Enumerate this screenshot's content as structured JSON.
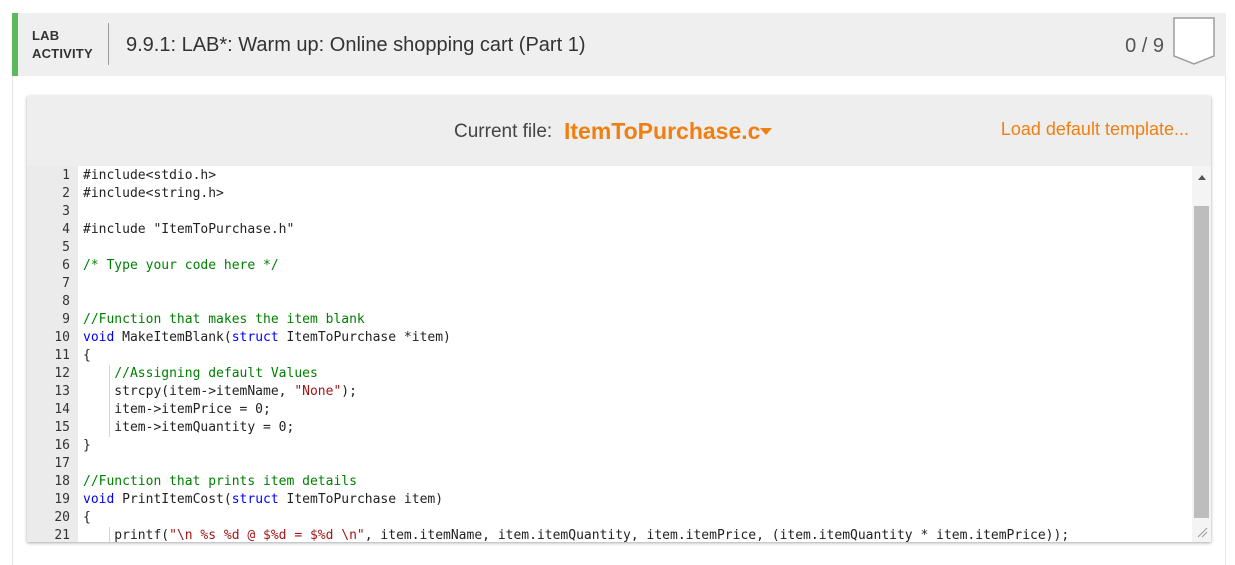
{
  "header": {
    "lab_label_line1": "LAB",
    "lab_label_line2": "ACTIVITY",
    "title": "9.9.1: LAB*: Warm up: Online shopping cart (Part 1)",
    "score": "0 / 9",
    "accent_color": "#5cb85c"
  },
  "file_bar": {
    "current_file_label": "Current file:",
    "current_file_name": "ItemToPurchase.c",
    "load_template": "Load default template...",
    "accent_color": "#f07f11"
  },
  "editor": {
    "lines": [
      {
        "num": "1",
        "text": "#include<stdio.h>"
      },
      {
        "num": "2",
        "text": "#include<string.h>"
      },
      {
        "num": "3",
        "text": ""
      },
      {
        "num": "4",
        "text": "#include \"ItemToPurchase.h\""
      },
      {
        "num": "5",
        "text": ""
      },
      {
        "num": "6",
        "text": "/* Type your code here */"
      },
      {
        "num": "7",
        "text": ""
      },
      {
        "num": "8",
        "text": ""
      },
      {
        "num": "9",
        "text": "//Function that makes the item blank"
      },
      {
        "num": "10",
        "text": "void MakeItemBlank(struct ItemToPurchase *item)"
      },
      {
        "num": "11",
        "text": "{"
      },
      {
        "num": "12",
        "text": "    //Assigning default Values"
      },
      {
        "num": "13",
        "text": "    strcpy(item->itemName, \"None\");"
      },
      {
        "num": "14",
        "text": "    item->itemPrice = 0;"
      },
      {
        "num": "15",
        "text": "    item->itemQuantity = 0;"
      },
      {
        "num": "16",
        "text": "}"
      },
      {
        "num": "17",
        "text": ""
      },
      {
        "num": "18",
        "text": "//Function that prints item details"
      },
      {
        "num": "19",
        "text": "void PrintItemCost(struct ItemToPurchase item)"
      },
      {
        "num": "20",
        "text": "{"
      },
      {
        "num": "21",
        "text": "    printf(\"\\n %s %d @ $%d = $%d \\n\", item.itemName, item.itemQuantity, item.itemPrice, (item.itemQuantity * item.itemPrice));"
      }
    ]
  }
}
